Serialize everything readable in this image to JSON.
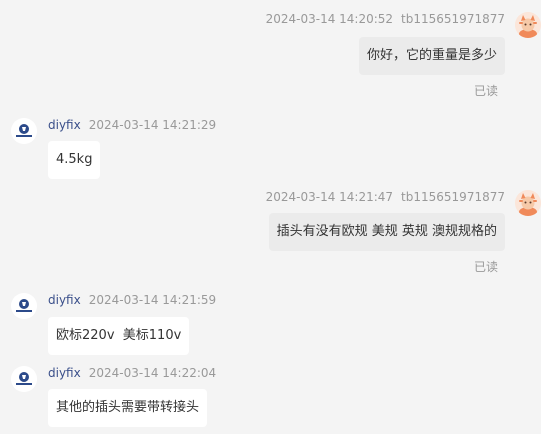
{
  "messages": [
    {
      "direction": "out",
      "time": "2024-03-14 14:20:52",
      "user": "tb115651971877",
      "text": "你好，它的重量是多少",
      "status": "已读"
    },
    {
      "direction": "in",
      "sender": "diyfix",
      "time": "2024-03-14 14:21:29",
      "text": "4.5kg"
    },
    {
      "direction": "out",
      "time": "2024-03-14 14:21:47",
      "user": "tb115651971877",
      "text": "插头有没有欧规 美规 英规 澳规规格的",
      "status": "已读"
    },
    {
      "direction": "in",
      "sender": "diyfix",
      "time": "2024-03-14 14:21:59",
      "text": "欧标220v  美标110v"
    },
    {
      "direction": "in",
      "sender": "diyfix",
      "time": "2024-03-14 14:22:04",
      "text": "其他的插头需要带转接头"
    }
  ],
  "icons": {
    "shop_avatar": "shop-logo-icon",
    "customer_avatar": "cat-avatar-icon"
  },
  "colors": {
    "background": "#f4f4f4",
    "incoming_bubble": "#ffffff",
    "outgoing_bubble": "#ebebeb",
    "sender_name": "#3a4f8a",
    "meta": "#999999"
  }
}
